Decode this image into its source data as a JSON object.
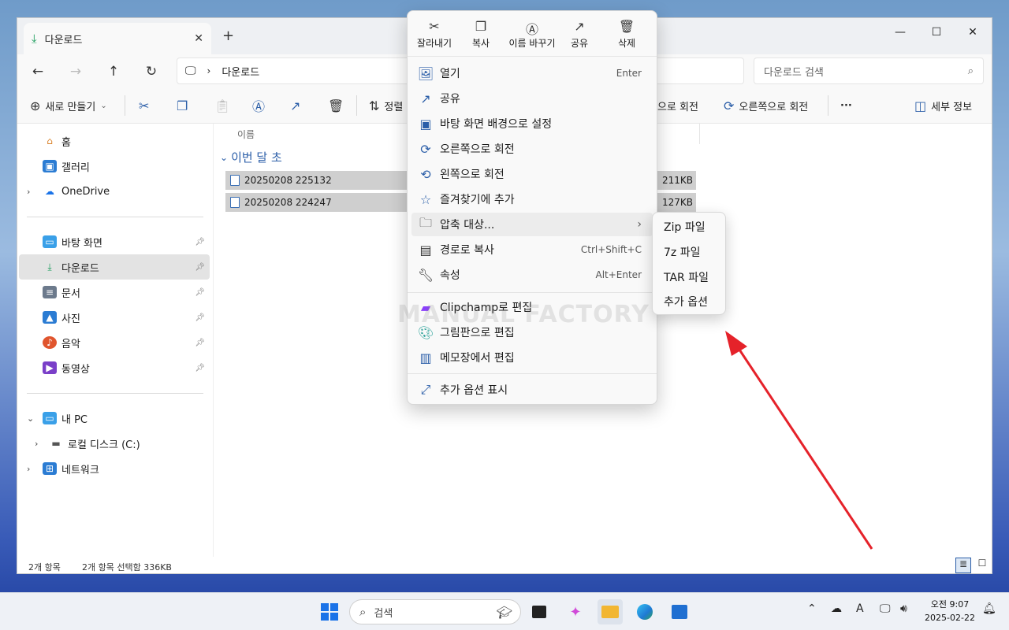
{
  "window": {
    "tab_title": "다운로드",
    "address_segment": "다운로드",
    "search_placeholder": "다운로드 검색"
  },
  "toolbar": {
    "new_label": "새로 만들기",
    "sort_label": "정렬",
    "rotate_left_label": "으로 회전",
    "rotate_right_label": "오른쪽으로 회전",
    "more_label": "···",
    "details_label": "세부 정보"
  },
  "sidebar": {
    "home": "홈",
    "gallery": "갤러리",
    "onedrive": "OneDrive",
    "desktop": "바탕 화면",
    "downloads": "다운로드",
    "documents": "문서",
    "pictures": "사진",
    "music": "음악",
    "videos": "동영상",
    "this_pc": "내 PC",
    "local_disk": "로컬 디스크 (C:)",
    "network": "네트워크"
  },
  "content": {
    "column_name": "이름",
    "group_label": "이번 달 초",
    "files": [
      {
        "name": "20250208 225132",
        "size": "211KB"
      },
      {
        "name": "20250208 224247",
        "size": "127KB"
      }
    ]
  },
  "status": {
    "item_count": "2개 항목",
    "selection": "2개 항목 선택함 336KB"
  },
  "context_menu": {
    "quick_actions": [
      "잘라내기",
      "복사",
      "이름 바꾸기",
      "공유",
      "삭제"
    ],
    "items": [
      {
        "label": "열기",
        "shortcut": "Enter"
      },
      {
        "label": "공유",
        "shortcut": ""
      },
      {
        "label": "바탕 화면 배경으로 설정",
        "shortcut": ""
      },
      {
        "label": "오른쪽으로 회전",
        "shortcut": ""
      },
      {
        "label": "왼쪽으로 회전",
        "shortcut": ""
      },
      {
        "label": "즐겨찾기에 추가",
        "shortcut": ""
      },
      {
        "label": "압축 대상...",
        "shortcut": ""
      },
      {
        "label": "경로로 복사",
        "shortcut": "Ctrl+Shift+C"
      },
      {
        "label": "속성",
        "shortcut": "Alt+Enter"
      },
      {
        "label": "Clipchamp로 편집",
        "shortcut": ""
      },
      {
        "label": "그림판으로 편집",
        "shortcut": ""
      },
      {
        "label": "메모장에서 편집",
        "shortcut": ""
      },
      {
        "label": "추가 옵션 표시",
        "shortcut": ""
      }
    ],
    "watermark": "MANUAL FACTORY"
  },
  "submenu": {
    "items": [
      "Zip 파일",
      "7z 파일",
      "TAR 파일",
      "추가 옵션"
    ]
  },
  "taskbar": {
    "search_label": "검색",
    "time": "오전 9:07",
    "date": "2025-02-22"
  },
  "colors": {
    "accent": "#2b5ea8",
    "arrow": "#e5222a"
  }
}
